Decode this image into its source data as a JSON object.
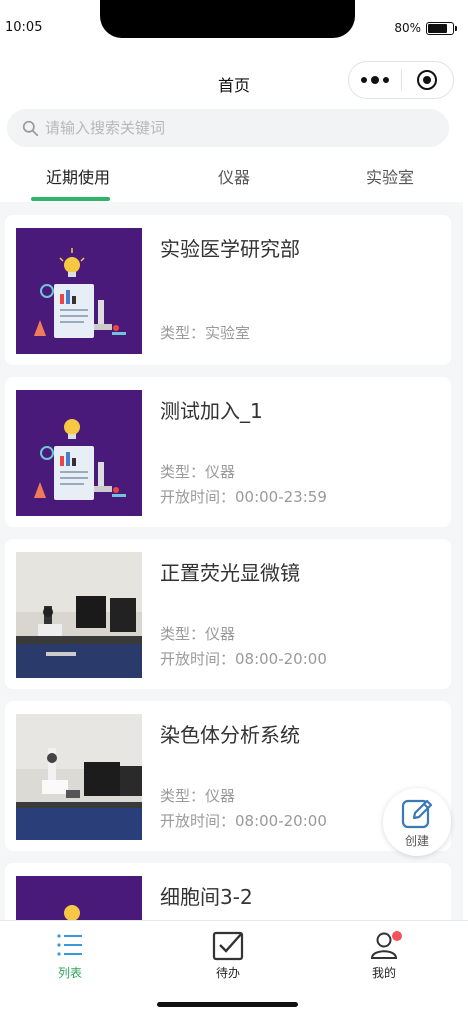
{
  "status_bar": {
    "time": "10:05",
    "battery": "80%",
    "battery_level": 0.8
  },
  "nav": {
    "title": "首页"
  },
  "search": {
    "placeholder": "请输入搜索关键词"
  },
  "tabs": [
    {
      "label": "近期使用",
      "active": true
    },
    {
      "label": "仪器",
      "active": false
    },
    {
      "label": "实验室",
      "active": false
    }
  ],
  "cards": [
    {
      "title": "实验医学研究部",
      "type": "类型：实验室",
      "hours": "",
      "image": "lab-illustration"
    },
    {
      "title": "测试加入_1",
      "type": "类型：仪器",
      "hours": "开放时间：00:00-23:59",
      "image": "lab-illustration"
    },
    {
      "title": "正置荧光显微镜",
      "type": "类型：仪器",
      "hours": "开放时间：08:00-20:00",
      "image": "microscope-photo"
    },
    {
      "title": "染色体分析系统",
      "type": "类型：仪器",
      "hours": "开放时间：08:00-20:00",
      "image": "microscope-photo"
    },
    {
      "title": "细胞间3-2",
      "type": "",
      "hours": "",
      "image": "lab-illustration"
    }
  ],
  "fab": {
    "label": "创建",
    "icon": "edit-icon"
  },
  "tabbar": [
    {
      "label": "列表",
      "icon": "list-icon",
      "active": true
    },
    {
      "label": "待办",
      "icon": "checkbox-icon",
      "active": false
    },
    {
      "label": "我的",
      "icon": "user-icon",
      "active": false,
      "badge": true
    }
  ],
  "colors": {
    "accent": "#2fb56a",
    "illustration_bg": "#4a1a7a"
  }
}
